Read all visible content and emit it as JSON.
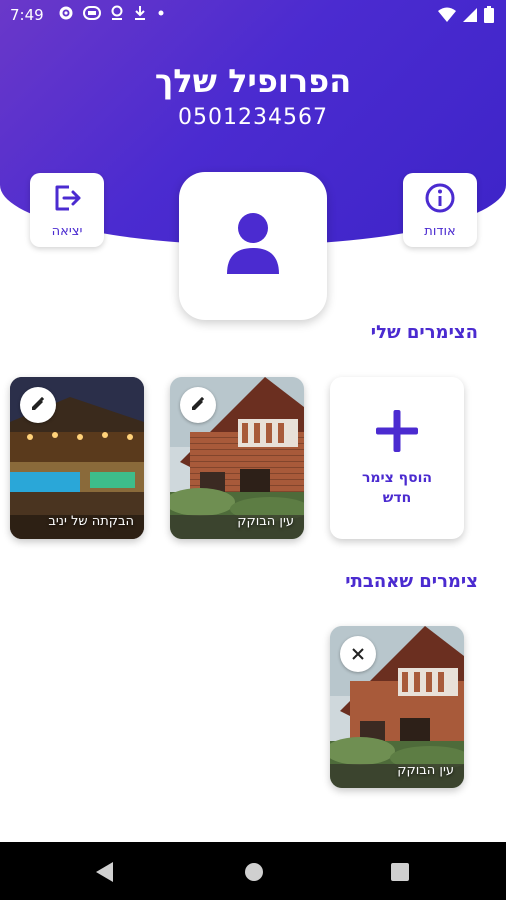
{
  "status_bar": {
    "time": "7:49",
    "left_icons": [
      "settings-icon",
      "disc-icon",
      "location-icon",
      "download-icon",
      "dot-icon"
    ],
    "right_icons": [
      "wifi-icon",
      "signal-icon",
      "battery-icon"
    ]
  },
  "header": {
    "title": "הפרופיל שלך",
    "phone": "0501234567",
    "logout_label": "יציאה",
    "about_label": "אודות"
  },
  "my_cabins": {
    "title": "הצימרים שלי",
    "add_label": "הוסף צימר חדש",
    "items": [
      {
        "name": "עין הבוקק",
        "action_icon": "edit-icon"
      },
      {
        "name": "הבקתה של יניב",
        "action_icon": "edit-icon"
      }
    ]
  },
  "favorite_cabins": {
    "title": "צימרים שאהבתי",
    "items": [
      {
        "name": "עין הבוקק",
        "action_icon": "close-icon"
      }
    ]
  },
  "colors": {
    "accent": "#4b2bd0",
    "header_gradient_start": "#6a38c9",
    "header_gradient_end": "#3d24c8"
  }
}
